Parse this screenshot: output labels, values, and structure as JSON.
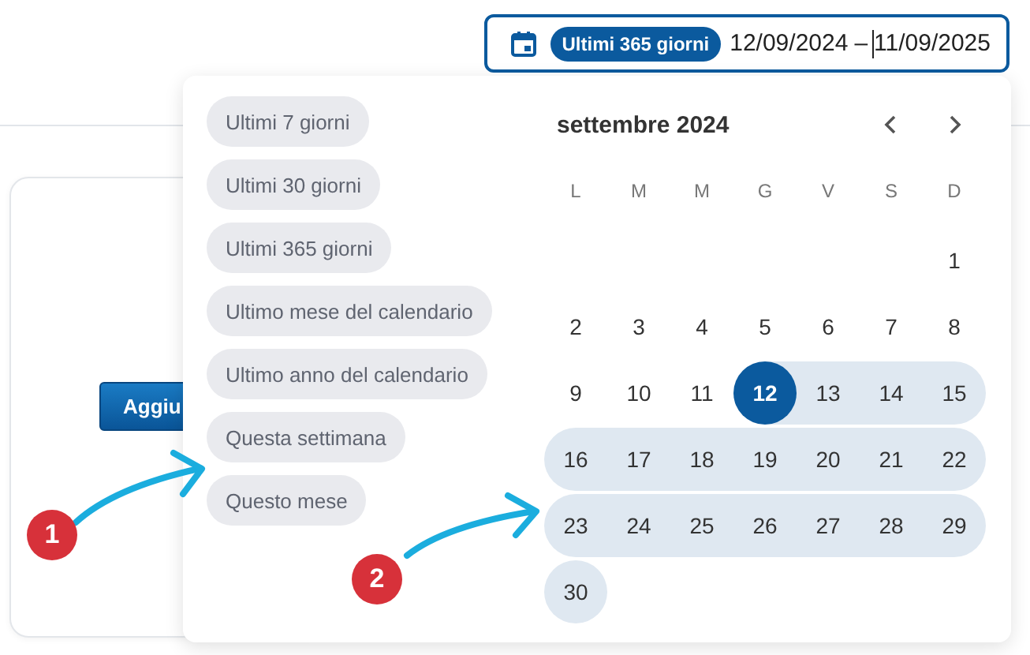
{
  "header": {
    "date_range": {
      "preset_chip": "Ultimi 365 giorni",
      "start": "12/09/2024",
      "separator": "–",
      "end": "11/09/2025"
    }
  },
  "card": {
    "button": "Aggiu"
  },
  "picker": {
    "presets": [
      {
        "label": "Ultimi 7 giorni"
      },
      {
        "label": "Ultimi 30 giorni"
      },
      {
        "label": "Ultimi 365 giorni"
      },
      {
        "label": "Ultimo mese del calendario"
      },
      {
        "label": "Ultimo anno del calendario"
      },
      {
        "label": "Questa settimana"
      },
      {
        "label": "Questo mese"
      }
    ],
    "calendar": {
      "month": "settembre 2024",
      "weekdays": [
        "L",
        "M",
        "M",
        "G",
        "V",
        "S",
        "D"
      ],
      "weeks": [
        {
          "days": [
            {
              "label": "1",
              "in_range": false,
              "selected": false
            }
          ]
        },
        {
          "days": [
            {
              "label": "2",
              "in_range": false,
              "selected": false
            },
            {
              "label": "3",
              "in_range": false,
              "selected": false
            },
            {
              "label": "4",
              "in_range": false,
              "selected": false
            },
            {
              "label": "5",
              "in_range": false,
              "selected": false
            },
            {
              "label": "6",
              "in_range": false,
              "selected": false
            },
            {
              "label": "7",
              "in_range": false,
              "selected": false
            },
            {
              "label": "8",
              "in_range": false,
              "selected": false
            }
          ]
        },
        {
          "days": [
            {
              "label": "9",
              "in_range": false,
              "selected": false
            },
            {
              "label": "10",
              "in_range": false,
              "selected": false
            },
            {
              "label": "11",
              "in_range": false,
              "selected": false
            },
            {
              "label": "12",
              "in_range": true,
              "selected": true
            },
            {
              "label": "13",
              "in_range": true,
              "selected": false
            },
            {
              "label": "14",
              "in_range": true,
              "selected": false
            },
            {
              "label": "15",
              "in_range": true,
              "selected": false
            }
          ]
        },
        {
          "days": [
            {
              "label": "16",
              "in_range": true,
              "selected": false
            },
            {
              "label": "17",
              "in_range": true,
              "selected": false
            },
            {
              "label": "18",
              "in_range": true,
              "selected": false
            },
            {
              "label": "19",
              "in_range": true,
              "selected": false
            },
            {
              "label": "20",
              "in_range": true,
              "selected": false
            },
            {
              "label": "21",
              "in_range": true,
              "selected": false
            },
            {
              "label": "22",
              "in_range": true,
              "selected": false
            }
          ]
        },
        {
          "days": [
            {
              "label": "23",
              "in_range": true,
              "selected": false
            },
            {
              "label": "24",
              "in_range": true,
              "selected": false
            },
            {
              "label": "25",
              "in_range": true,
              "selected": false
            },
            {
              "label": "26",
              "in_range": true,
              "selected": false
            },
            {
              "label": "27",
              "in_range": true,
              "selected": false
            },
            {
              "label": "28",
              "in_range": true,
              "selected": false
            },
            {
              "label": "29",
              "in_range": true,
              "selected": false
            }
          ]
        },
        {
          "days": [
            {
              "label": "30",
              "in_range": true,
              "selected": false
            }
          ]
        }
      ]
    }
  },
  "annotations": [
    {
      "label": "1"
    },
    {
      "label": "2"
    }
  ]
}
